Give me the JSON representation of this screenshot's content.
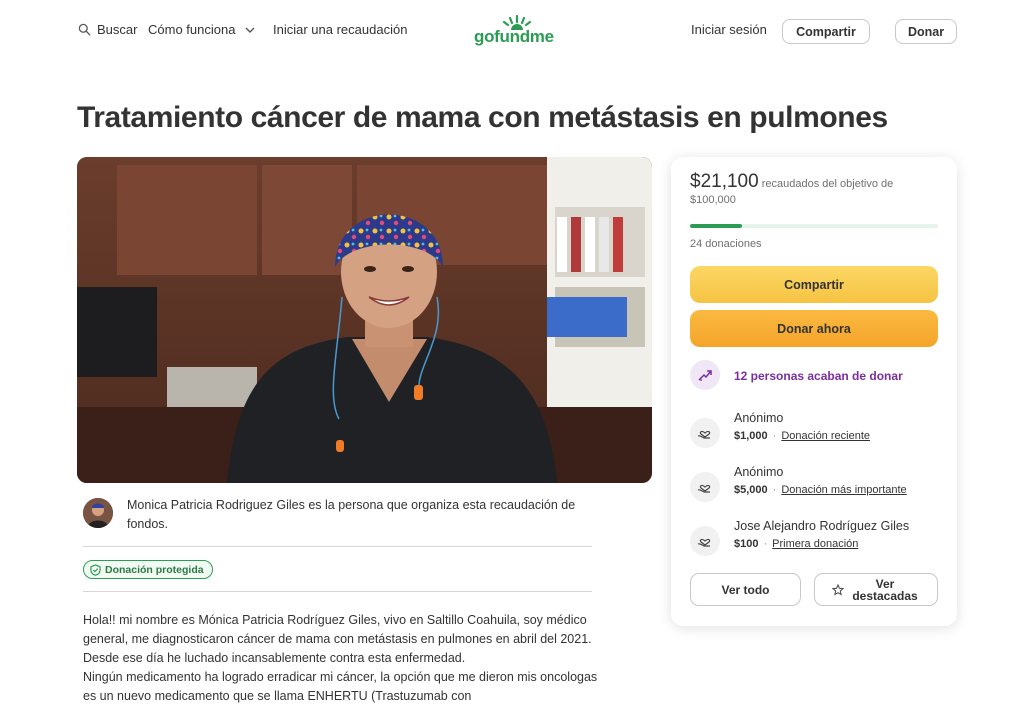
{
  "header": {
    "search_label": "Buscar",
    "how_label": "Cómo funciona",
    "start_label": "Iniciar una recaudación",
    "logo_text": "gofundme",
    "login_label": "Iniciar sesión",
    "share_label": "Compartir",
    "donate_label": "Donar"
  },
  "campaign": {
    "title": "Tratamiento cáncer de mama con metástasis en pulmones",
    "organizer_text": "Monica Patricia Rodriguez Giles es la persona que organiza esta recaudación de fondos.",
    "protected_label": "Donación protegida",
    "story": [
      "Hola!! mi nombre es Mónica Patricia Rodríguez Giles, vivo en Saltillo Coahuila, soy médico general, me diagnosticaron cáncer de mama con metástasis en pulmones en abril del 2021.",
      "Desde ese día he luchado incansablemente contra esta enfermedad.",
      "Ningún medicamento ha logrado erradicar mi cáncer, la opción que me dieron mis oncologas es un nuevo medicamento que se llama ENHERTU (Trastuzumab con"
    ]
  },
  "card": {
    "raised_amount": "$21,100",
    "raised_suffix": "recaudados del objetivo de $100,000",
    "progress_fraction": 0.211,
    "donations_count": "24 donaciones",
    "share_label": "Compartir",
    "donate_now_label": "Donar ahora",
    "recent_label": "12 personas acaban de donar",
    "donations": [
      {
        "name": "Anónimo",
        "amount": "$1,000",
        "tag": "Donación reciente"
      },
      {
        "name": "Anónimo",
        "amount": "$5,000",
        "tag": "Donación más importante"
      },
      {
        "name": "Jose Alejandro Rodríguez Giles",
        "amount": "$100",
        "tag": "Primera donación"
      }
    ],
    "see_all_label": "Ver todo",
    "see_featured_label": "Ver destacadas"
  },
  "colors": {
    "brand_green": "#2b9c54",
    "share_yellow": "#f6c343",
    "donate_orange": "#f4a52a",
    "recent_purple": "#7a2fa0"
  },
  "icons": {
    "search": "search-icon",
    "chevron": "chevron-down-icon",
    "shield": "shield-check-icon",
    "trend": "trending-up-icon",
    "heart_hand": "heart-hand-icon",
    "star": "star-icon"
  }
}
